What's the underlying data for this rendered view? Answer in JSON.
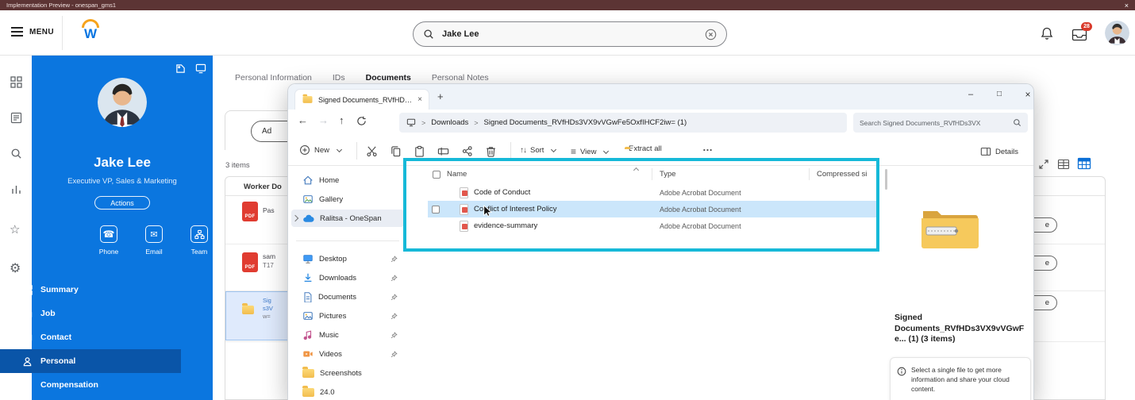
{
  "banner": {
    "title": "Implementation Preview - onespan_gms1"
  },
  "header": {
    "menu": "MENU",
    "logo_letter": "W",
    "search_value": "Jake Lee",
    "mail_badge": "28"
  },
  "sidebar": {
    "name": "Jake Lee",
    "title": "Executive VP, Sales & Marketing",
    "actions": "Actions",
    "quick": [
      {
        "label": "Phone"
      },
      {
        "label": "Email"
      },
      {
        "label": "Team"
      }
    ],
    "menu": [
      {
        "label": "Summary"
      },
      {
        "label": "Job"
      },
      {
        "label": "Contact"
      },
      {
        "label": "Personal"
      },
      {
        "label": "Compensation"
      }
    ]
  },
  "workday": {
    "tabs": [
      {
        "label": "Personal Information"
      },
      {
        "label": "IDs"
      },
      {
        "label": "Documents"
      },
      {
        "label": "Personal Notes"
      }
    ],
    "add_button": "Ad",
    "items_count": "3 items",
    "col_header": "Worker Do",
    "rows": [
      {
        "badge": "PDF",
        "line1": "Pas",
        "line2": "",
        "line3": ""
      },
      {
        "badge": "PDF",
        "line1": "sam",
        "line2": "T17",
        "line3": ""
      },
      {
        "badge": "",
        "line1": "Sig",
        "line2": "s3V",
        "line3": "w="
      }
    ],
    "row_buttons": [
      "e",
      "e",
      "e"
    ]
  },
  "explorer": {
    "tab_title": "Signed Documents_RVfHDs3V",
    "breadcrumb": {
      "items": [
        "Downloads",
        "Signed Documents_RVfHDs3VX9vVGwFe5OxfIHCF2iw= (1)"
      ]
    },
    "search": "Search Signed Documents_RVfHDs3VX",
    "toolbar": {
      "new": "New",
      "sort": "Sort",
      "view": "View",
      "extract": "Extract all",
      "details": "Details"
    },
    "nav": [
      {
        "label": "Home"
      },
      {
        "label": "Gallery"
      },
      {
        "label": "Ralitsa - OneSpan"
      },
      {
        "label": "Desktop"
      },
      {
        "label": "Downloads"
      },
      {
        "label": "Documents"
      },
      {
        "label": "Pictures"
      },
      {
        "label": "Music"
      },
      {
        "label": "Videos"
      },
      {
        "label": "Screenshots"
      },
      {
        "label": "24.0"
      }
    ],
    "columns": {
      "name": "Name",
      "type": "Type",
      "compressed": "Compressed si"
    },
    "files": [
      {
        "name": "Code of Conduct",
        "type": "Adobe Acrobat Document"
      },
      {
        "name": "Conflict of Interest Policy",
        "type": "Adobe Acrobat Document"
      },
      {
        "name": "evidence-summary",
        "type": "Adobe Acrobat Document"
      }
    ],
    "preview": {
      "title": "Signed Documents_RVfHDs3VX9vVGwFe... (1) (3 items)",
      "hint": "Select a single file to get more information and share your cloud content."
    }
  },
  "icons": {
    "close": "×",
    "minimize": "–",
    "maximize": "□",
    "new_tab": "+",
    "back": "←",
    "forward": "→",
    "up": "↑",
    "breadcrumb_sep": ">",
    "star": "☆",
    "gear": "⚙",
    "phone": "☎",
    "email": "✉",
    "view_lines": "≡",
    "sort_arrows": "↑↓",
    "more": "…"
  }
}
